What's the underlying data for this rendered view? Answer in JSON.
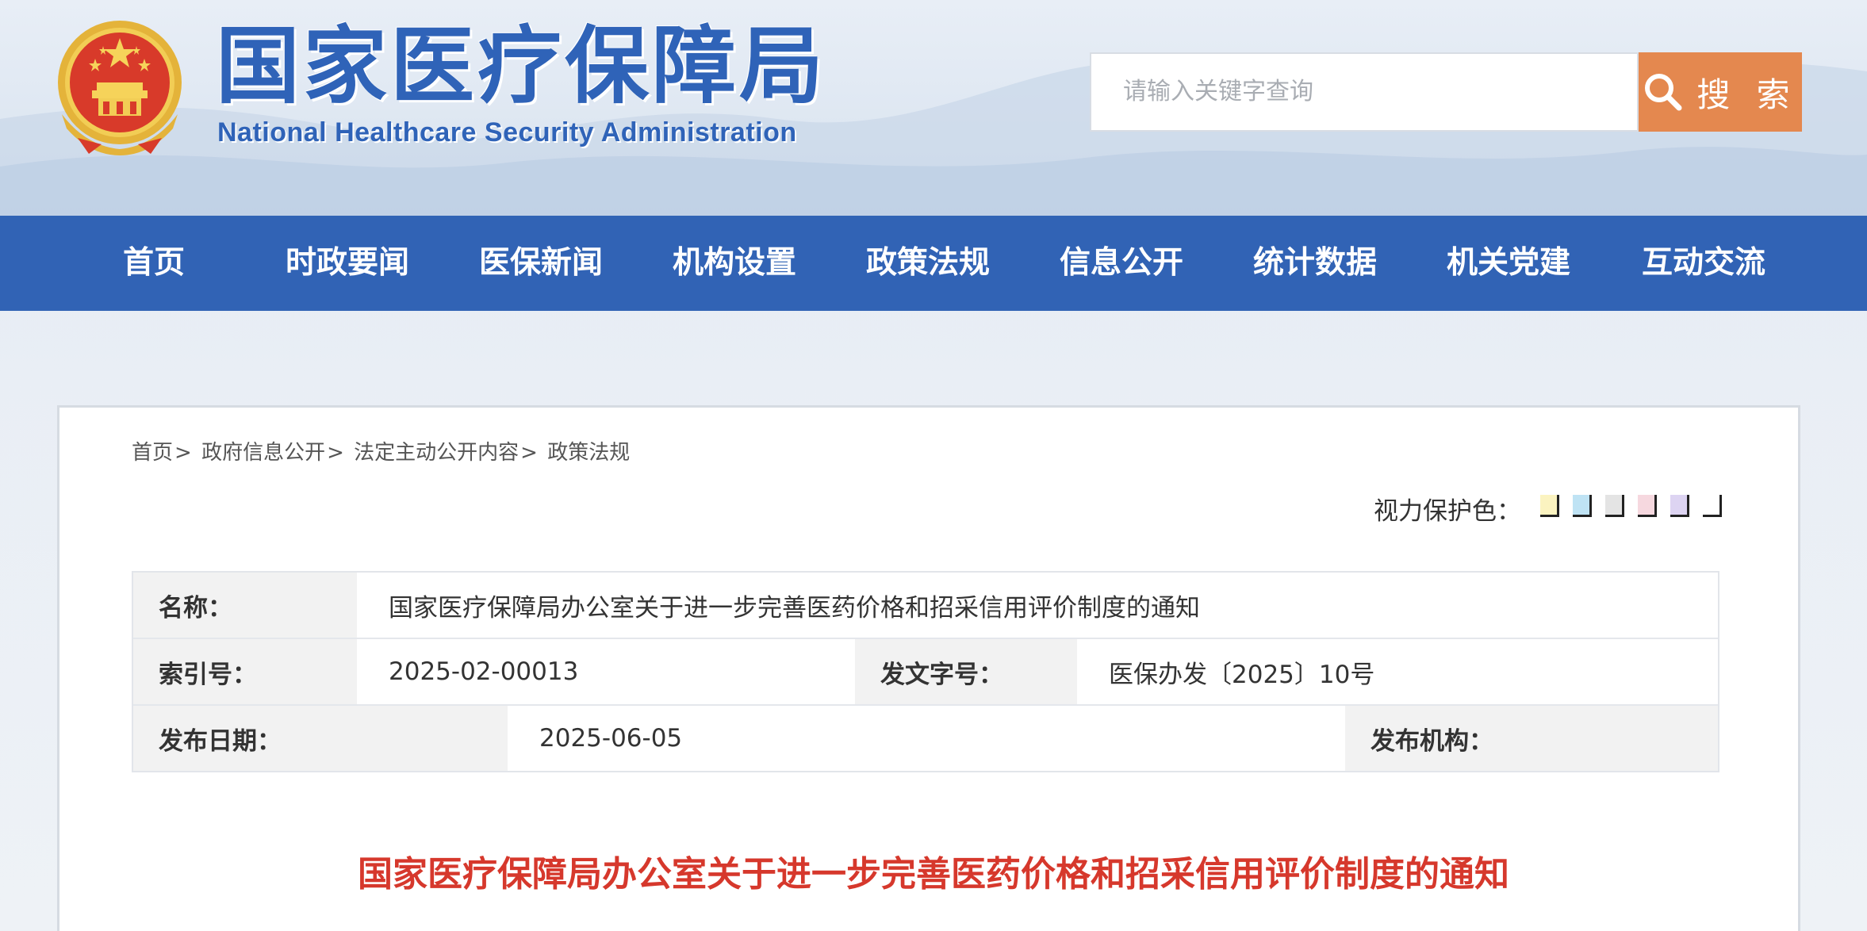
{
  "header": {
    "title_cn": "国家医疗保障局",
    "title_en": "National Healthcare Security Administration",
    "search_placeholder": "请输入关键字查询",
    "search_button_label": "搜 索"
  },
  "nav": {
    "items": [
      "首页",
      "时政要闻",
      "医保新闻",
      "机构设置",
      "政策法规",
      "信息公开",
      "统计数据",
      "机关党建",
      "互动交流"
    ]
  },
  "breadcrumb": {
    "items": [
      "首页",
      "政府信息公开",
      "法定主动公开内容",
      "政策法规"
    ],
    "separator": ">"
  },
  "eye_protection": {
    "label": "视力保护色：",
    "colors": [
      "#fbf3c0",
      "#bfe3f4",
      "#e4e4e4",
      "#f6d8df",
      "#ddd4f2",
      "#ffffff"
    ]
  },
  "info_table": {
    "name_label": "名称：",
    "name_value": "国家医疗保障局办公室关于进一步完善医药价格和招采信用评价制度的通知",
    "index_label": "索引号：",
    "index_value": "2025-02-00013",
    "doc_no_label": "发文字号：",
    "doc_no_value": "医保办发〔2025〕10号",
    "date_label": "发布日期：",
    "date_value": "2025-06-05",
    "agency_label": "发布机构：",
    "agency_value": ""
  },
  "document": {
    "title": "国家医疗保障局办公室关于进一步完善医药价格和招采信用评价制度的通知"
  },
  "colors": {
    "nav_blue": "#3163b5",
    "search_orange": "#e4884f",
    "title_red": "#d6382c"
  }
}
